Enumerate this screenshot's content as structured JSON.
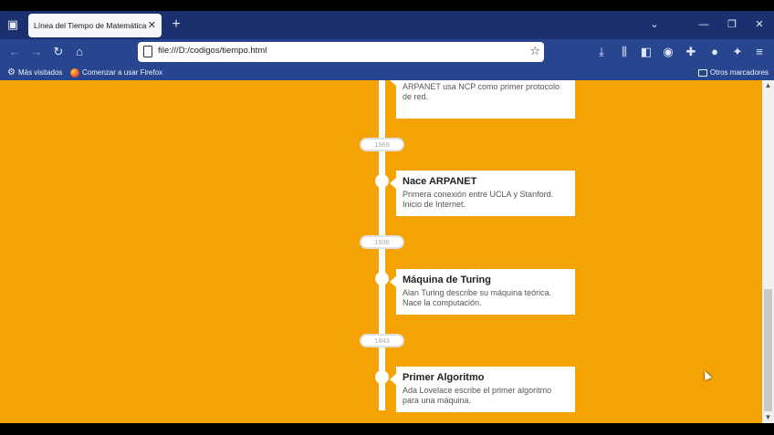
{
  "browser": {
    "tab_title": "Línea del Tiempo de Matemáticas e",
    "url": "file:///D:/codigos/tiempo.html",
    "bookmarks": [
      "Más visitados",
      "Comenzar a usar Firefox"
    ],
    "other_bookmarks": "Otros marcadores"
  },
  "timeline": {
    "top_card": {
      "desc": "ARPANET usa NCP como primer protocolo de red."
    },
    "items": [
      {
        "year": "1969",
        "title": "Nace ARPANET",
        "desc": "Primera conexión entre UCLA y Stanford. Inicio de Internet."
      },
      {
        "year": "1936",
        "title": "Máquina de Turing",
        "desc": "Alan Turing describe su máquina teórica. Nace la computación."
      },
      {
        "year": "1843",
        "title": "Primer Algoritmo",
        "desc": "Ada Lovelace escribe el primer algoritmo para una máquina."
      }
    ]
  },
  "colors": {
    "background": "#f5a303",
    "tabbar": "#1c2f6e",
    "navbar": "#28458f"
  },
  "icons": [
    "tab-list-icon",
    "close-icon",
    "plus-icon",
    "chevron-down-icon",
    "minimize-icon",
    "restore-icon",
    "back-arrow-icon",
    "forward-arrow-icon",
    "reload-icon",
    "home-icon",
    "page-icon",
    "star-icon",
    "download-icon",
    "library-icon",
    "sidebar-icon",
    "account-icon",
    "extensions-icon",
    "menu-icon",
    "gear-icon",
    "firefox-icon",
    "folder-icon"
  ]
}
